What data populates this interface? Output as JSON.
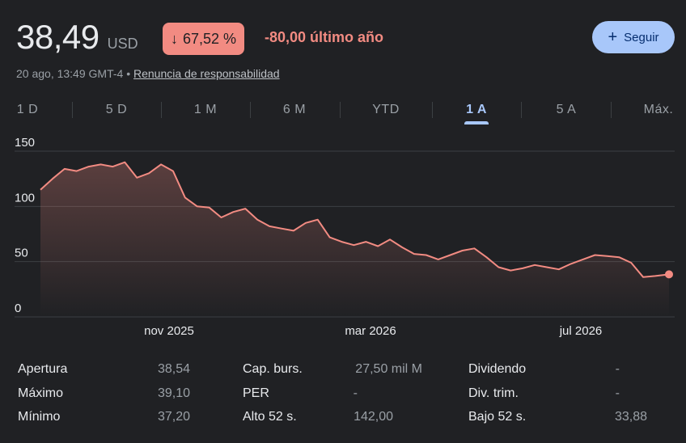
{
  "header": {
    "price": "38,49",
    "currency": "USD",
    "change_percent": "67,52 %",
    "change_arrow": "↓",
    "change_text": "-80,00 último año",
    "follow_label": "Seguir",
    "timestamp": "20 ago, 13:49 GMT-4",
    "separator": "•",
    "disclaimer": "Renuncia de responsabilidad"
  },
  "tabs": [
    {
      "label": "1 D",
      "active": false
    },
    {
      "label": "5 D",
      "active": false
    },
    {
      "label": "1 M",
      "active": false
    },
    {
      "label": "6 M",
      "active": false
    },
    {
      "label": "YTD",
      "active": false
    },
    {
      "label": "1 A",
      "active": true
    },
    {
      "label": "5 A",
      "active": false
    },
    {
      "label": "Máx.",
      "active": false
    }
  ],
  "colors": {
    "line": "#f28b82",
    "accent": "#a8c7fa",
    "negative": "#f28b82"
  },
  "chart_data": {
    "type": "area",
    "ylim": [
      0,
      150
    ],
    "yticks": [
      "150",
      "100",
      "50",
      "0"
    ],
    "xticks": [
      "nov 2025",
      "mar 2026",
      "jul 2026"
    ],
    "x": [
      "2025-08-20",
      "2025-08-27",
      "2025-09-03",
      "2025-09-10",
      "2025-09-17",
      "2025-09-24",
      "2025-10-01",
      "2025-10-08",
      "2025-10-15",
      "2025-10-22",
      "2025-10-29",
      "2025-11-05",
      "2025-11-12",
      "2025-11-19",
      "2025-11-26",
      "2025-12-03",
      "2025-12-10",
      "2025-12-17",
      "2025-12-24",
      "2025-12-31",
      "2026-01-07",
      "2026-01-14",
      "2026-01-21",
      "2026-01-28",
      "2026-02-04",
      "2026-02-11",
      "2026-02-18",
      "2026-02-25",
      "2026-03-04",
      "2026-03-11",
      "2026-03-18",
      "2026-03-25",
      "2026-04-01",
      "2026-04-08",
      "2026-04-15",
      "2026-04-22",
      "2026-04-29",
      "2026-05-06",
      "2026-05-13",
      "2026-05-20",
      "2026-05-27",
      "2026-06-03",
      "2026-06-10",
      "2026-06-17",
      "2026-06-24",
      "2026-07-01",
      "2026-07-08",
      "2026-07-15",
      "2026-07-22",
      "2026-07-29",
      "2026-08-05",
      "2026-08-12",
      "2026-08-20"
    ],
    "values": [
      115,
      125,
      134,
      132,
      136,
      138,
      136,
      140,
      126,
      130,
      138,
      132,
      108,
      100,
      99,
      90,
      95,
      98,
      88,
      82,
      80,
      78,
      85,
      88,
      72,
      68,
      65,
      68,
      64,
      70,
      63,
      57,
      56,
      52,
      56,
      60,
      62,
      54,
      45,
      42,
      44,
      47,
      45,
      43,
      48,
      52,
      56,
      55,
      54,
      49,
      36,
      37,
      38.49
    ],
    "last_value": 38.49
  },
  "stats": [
    {
      "label": "Apertura",
      "value": "38,54"
    },
    {
      "label": "Máximo",
      "value": "39,10"
    },
    {
      "label": "Mínimo",
      "value": "37,20"
    },
    {
      "label": "Cap. burs.",
      "value": "27,50 mil M"
    },
    {
      "label": "PER",
      "value": "-"
    },
    {
      "label": "Alto 52 s.",
      "value": "142,00"
    },
    {
      "label": "Dividendo",
      "value": "-"
    },
    {
      "label": "Div. trim.",
      "value": "-"
    },
    {
      "label": "Bajo 52 s.",
      "value": "33,88"
    }
  ]
}
